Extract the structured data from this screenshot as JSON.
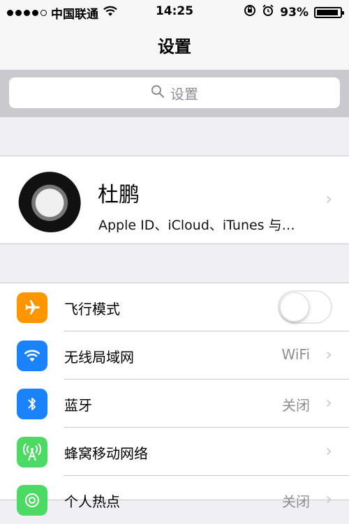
{
  "status": {
    "carrier": "中国联通",
    "time": "14:25",
    "battery": "93%",
    "battery_level": 0.93
  },
  "nav": {
    "title": "设置"
  },
  "search": {
    "placeholder": "设置"
  },
  "profile": {
    "name": "杜鹏",
    "subtitle": "Apple ID、iCloud、iTunes 与…"
  },
  "settings": [
    {
      "label": "飞行模式",
      "icon": "airplane-icon",
      "color": "#ff9500",
      "toggle": false
    },
    {
      "label": "无线局域网",
      "icon": "wifi-icon",
      "color": "#1a82fb",
      "value": "WiFi"
    },
    {
      "label": "蓝牙",
      "icon": "bluetooth-icon",
      "color": "#1a82fb",
      "value": "关闭"
    },
    {
      "label": "蜂窝移动网络",
      "icon": "cellular-icon",
      "color": "#4cd964",
      "value": ""
    },
    {
      "label": "个人热点",
      "icon": "hotspot-icon",
      "color": "#4cd964",
      "value": "关闭"
    }
  ],
  "colors": {
    "background": "#efeff4",
    "separator": "#c8c7cc"
  }
}
